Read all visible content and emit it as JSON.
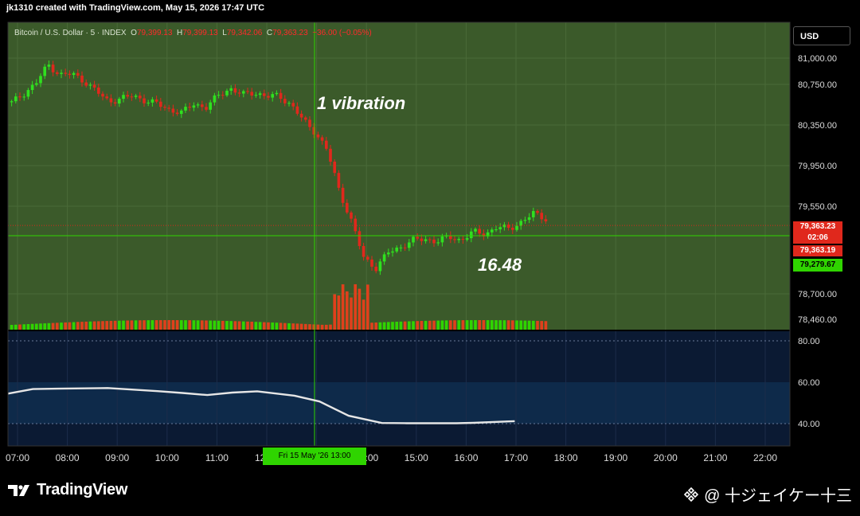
{
  "header": {
    "creator_text": "jk1310 created with TradingView.com, May 15, 2026 17:47 UTC"
  },
  "legend": {
    "symbol": "Bitcoin / U.S. Dollar · 5 · INDEX",
    "o_label": "O",
    "o_value": "79,399.13",
    "h_label": "H",
    "h_value": "79,399.13",
    "l_label": "L",
    "l_value": "79,342.06",
    "c_label": "C",
    "c_value": "79,363.23",
    "change": "−36.00 (−0.05%)"
  },
  "currency_button": {
    "label": "USD"
  },
  "badges": {
    "price_last": "79,363.23",
    "countdown": "02:06",
    "price_bid": "79,363.19",
    "price_cross": "79,279.67"
  },
  "annotations": {
    "vibration": "1 vibration",
    "value": "16.48"
  },
  "crosshair": {
    "time_label": "Fri 15 May '26   13:00"
  },
  "colors": {
    "chart_bg": "#3b5a2a",
    "indicator_bg": "#0b1a33",
    "band_bg": "#0e2a4a",
    "up": "#2fe01f",
    "down": "#e0281c",
    "crosshair": "#2fd400",
    "rsi_line": "#e6e6e6"
  },
  "chart_data": [
    {
      "type": "candlestick",
      "title": "Bitcoin / U.S. Dollar · 5 · INDEX",
      "price_ticks": [
        "81,000.00",
        "80,750.00",
        "80,350.00",
        "79,950.00",
        "79,550.00",
        "78,700.00",
        "78,460.00"
      ],
      "time_ticks": [
        "07:00",
        "08:00",
        "09:00",
        "10:00",
        "11:00",
        "12:00",
        "13:00",
        "14:00",
        "15:00",
        "16:00",
        "17:00",
        "18:00",
        "19:00",
        "20:00",
        "21:00",
        "22:00"
      ],
      "close_path": [
        80570,
        80660,
        80760,
        80940,
        80840,
        80850,
        80780,
        80680,
        80580,
        80610,
        80640,
        80590,
        80560,
        80500,
        80470,
        80560,
        80520,
        80640,
        80710,
        80650,
        80670,
        80630,
        80640,
        80550,
        80400,
        80280,
        80100,
        79700,
        79400,
        79050,
        78950,
        79100,
        79150,
        79220,
        79230,
        79210,
        79250,
        79220,
        79300,
        79280,
        79350,
        79330,
        79400,
        79480,
        79430
      ],
      "crosshair_price": 79279.67,
      "last_price": 79363.23
    },
    {
      "type": "line",
      "y_ticks": [
        "80.00",
        "60.00",
        "40.00"
      ],
      "band": [
        40,
        60
      ],
      "x": [
        "07:00",
        "07:30",
        "08:00",
        "09:00",
        "10:00",
        "10:30",
        "11:00",
        "11:30",
        "12:00",
        "12:45",
        "13:15",
        "13:50",
        "14:30",
        "15:00",
        "16:00",
        "16:20",
        "17:10"
      ],
      "values": [
        54.5,
        56.7,
        56.9,
        57.2,
        55.7,
        54.8,
        53.8,
        55,
        55.6,
        53.5,
        50.7,
        43.8,
        40.3,
        40.2,
        40.2,
        40.4,
        41.2
      ]
    }
  ]
}
